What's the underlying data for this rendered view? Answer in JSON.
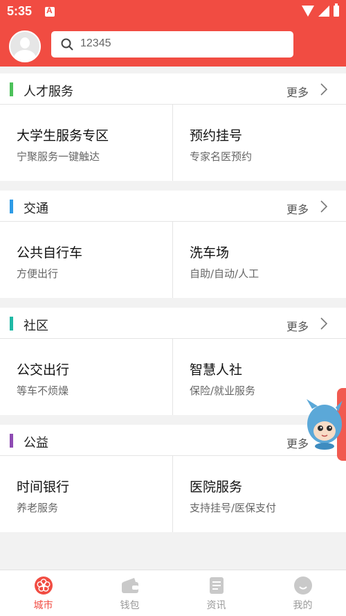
{
  "status": {
    "time": "5:35"
  },
  "search": {
    "value": "12345"
  },
  "colors": {
    "brand": "#f14c42",
    "bar_talent": "#4cc15a",
    "bar_traffic": "#2e9be6",
    "bar_community": "#1fb9a5",
    "bar_welfare": "#8e4bb3"
  },
  "sections": [
    {
      "title": "人才服务",
      "more": "更多",
      "items": [
        {
          "title": "大学生服务专区",
          "sub": "宁聚服务一键触达"
        },
        {
          "title": "预约挂号",
          "sub": "专家名医预约"
        }
      ]
    },
    {
      "title": "交通",
      "more": "更多",
      "items": [
        {
          "title": "公共自行车",
          "sub": "方便出行"
        },
        {
          "title": "洗车场",
          "sub": "自助/自动/人工"
        }
      ]
    },
    {
      "title": "社区",
      "more": "更多",
      "items": [
        {
          "title": "公交出行",
          "sub": "等车不烦燥"
        },
        {
          "title": "智慧人社",
          "sub": "保险/就业服务"
        }
      ]
    },
    {
      "title": "公益",
      "more": "更多",
      "items": [
        {
          "title": "时间银行",
          "sub": "养老服务"
        },
        {
          "title": "医院服务",
          "sub": "支持挂号/医保支付"
        }
      ]
    }
  ],
  "tabs": [
    {
      "label": "城市",
      "icon": "city-flower-icon",
      "active": true
    },
    {
      "label": "钱包",
      "icon": "wallet-icon"
    },
    {
      "label": "资讯",
      "icon": "news-icon"
    },
    {
      "label": "我的",
      "icon": "profile-face-icon"
    }
  ]
}
